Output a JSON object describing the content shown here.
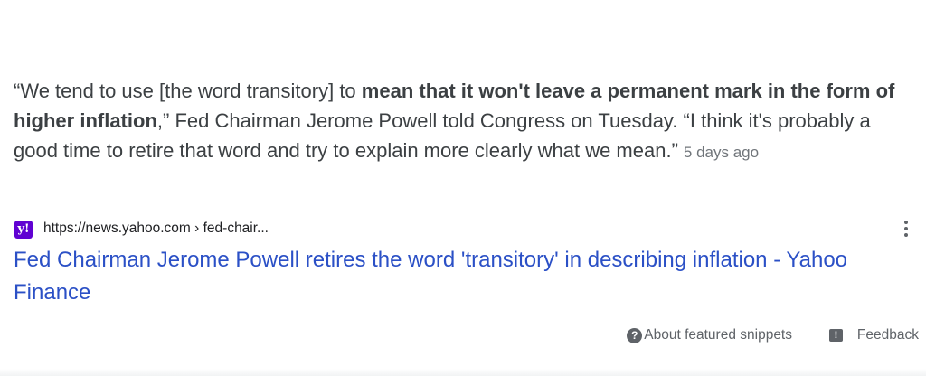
{
  "snippet": {
    "part1": "“We tend to use [the word transitory] to ",
    "bold": "mean that it won't leave a permanent mark in the form of higher inflation",
    "part2": ",” Fed Chairman Jerome Powell told Congress on Tuesday. “I think it's probably a good time to retire that word and try to explain more clearly what we mean.”",
    "date": "5 days ago"
  },
  "source": {
    "favicon_letter": "y!",
    "favicon_icon": "yahoo-logo-icon",
    "url": "https://news.yahoo.com › fed-chair..."
  },
  "result": {
    "title": "Fed Chairman Jerome Powell retires the word 'transitory' in describing inflation - Yahoo Finance"
  },
  "footer": {
    "about_label": "About featured snippets",
    "feedback_label": "Feedback",
    "help_icon_glyph": "?",
    "feedback_icon_glyph": "!"
  },
  "colors": {
    "link": "#2b50c6",
    "text": "#3c4043",
    "muted": "#70757a",
    "brand_yahoo": "#6001d2"
  }
}
